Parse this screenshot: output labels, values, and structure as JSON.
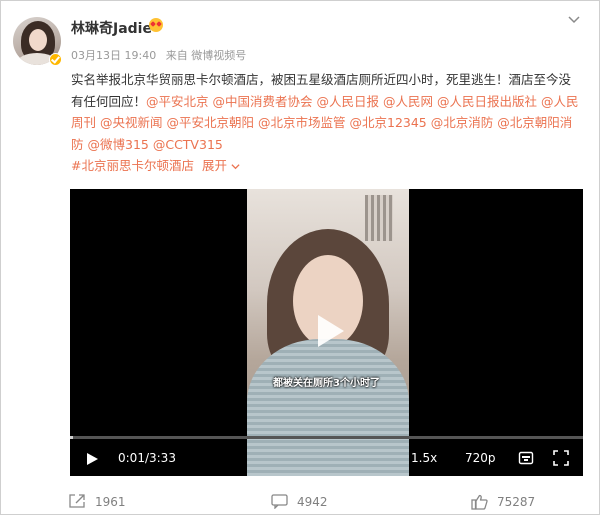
{
  "post": {
    "username": "林琳奇Jadie",
    "date": "03月13日 19:40",
    "source": "来自 微博视频号",
    "text_lead": "实名举报北京华贸丽思卡尔顿酒店，被困五星级酒店厕所近四小时，死里逃生！酒店至今没有任何回应！",
    "mentions": [
      "@平安北京",
      "@中国消费者协会",
      "@人民日报",
      "@人民网",
      "@人民日报出版社",
      "@人民周刊",
      "@央视新闻",
      "@平安北京朝阳",
      "@北京市场监管",
      "@北京12345",
      "@北京消防",
      "@北京朝阳消防",
      "@微博315",
      "@CCTV315"
    ],
    "hashtag": "#北京丽思卡尔顿酒店",
    "expand_label": "展开",
    "expand_icon": "chevron-down-icon"
  },
  "video": {
    "subtitle": "都被关在厕所3个小时了",
    "current_time": "0:01",
    "duration": "3:33",
    "speed": "1.5x",
    "quality": "720p",
    "progress": 0.005
  },
  "actions": {
    "repost_count": "1961",
    "comment_count": "4942",
    "like_count": "75287"
  },
  "colors": {
    "link": "#eb7350",
    "badge": "#ffb800",
    "video_bg": "#000000"
  }
}
